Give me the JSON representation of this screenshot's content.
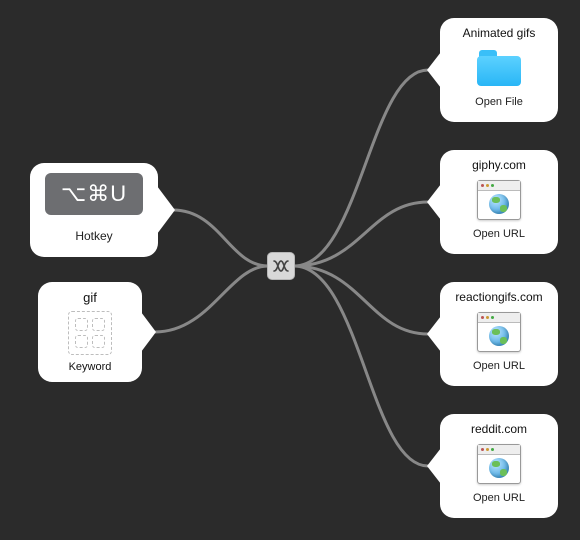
{
  "inputs": {
    "hotkey": {
      "combo": "⌥⌘U",
      "label": "Hotkey"
    },
    "keyword": {
      "text": "gif",
      "label": "Keyword"
    }
  },
  "junction": {
    "name": "junction"
  },
  "outputs": [
    {
      "title": "Animated gifs",
      "action": "Open File",
      "icon": "folder"
    },
    {
      "title": "giphy.com",
      "action": "Open URL",
      "icon": "url"
    },
    {
      "title": "reactiongifs.com",
      "action": "Open URL",
      "icon": "url"
    },
    {
      "title": "reddit.com",
      "action": "Open URL",
      "icon": "url"
    }
  ]
}
